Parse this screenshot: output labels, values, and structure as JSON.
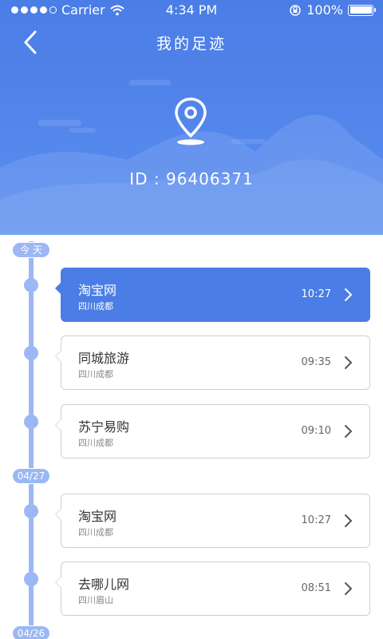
{
  "status_bar": {
    "carrier": "Carrier",
    "time": "4:34 PM",
    "battery": "100%"
  },
  "header": {
    "title": "我的足迹",
    "user_id": "ID : 96406371"
  },
  "timeline": {
    "groups": [
      {
        "date": "今 天",
        "entries": [
          {
            "name": "淘宝网",
            "location": "四川成都",
            "time": "10:27",
            "active": true
          },
          {
            "name": "同城旅游",
            "location": "四川成都",
            "time": "09:35",
            "active": false
          },
          {
            "name": "苏宁易购",
            "location": "四川成都",
            "time": "09:10",
            "active": false
          }
        ]
      },
      {
        "date": "04/27",
        "entries": [
          {
            "name": "淘宝网",
            "location": "四川成都",
            "time": "10:27",
            "active": false
          },
          {
            "name": "去哪儿网",
            "location": "四川眉山",
            "time": "08:51",
            "active": false
          }
        ]
      },
      {
        "date": "04/26",
        "entries": []
      }
    ]
  },
  "colors": {
    "primary": "#4a7de6",
    "timeline": "#9cb8f4",
    "header_gradient_end": "#5b8ef0"
  },
  "icons": {
    "back": "chevron-left-icon",
    "pin": "location-pin-icon",
    "chevron": "chevron-right-icon"
  }
}
